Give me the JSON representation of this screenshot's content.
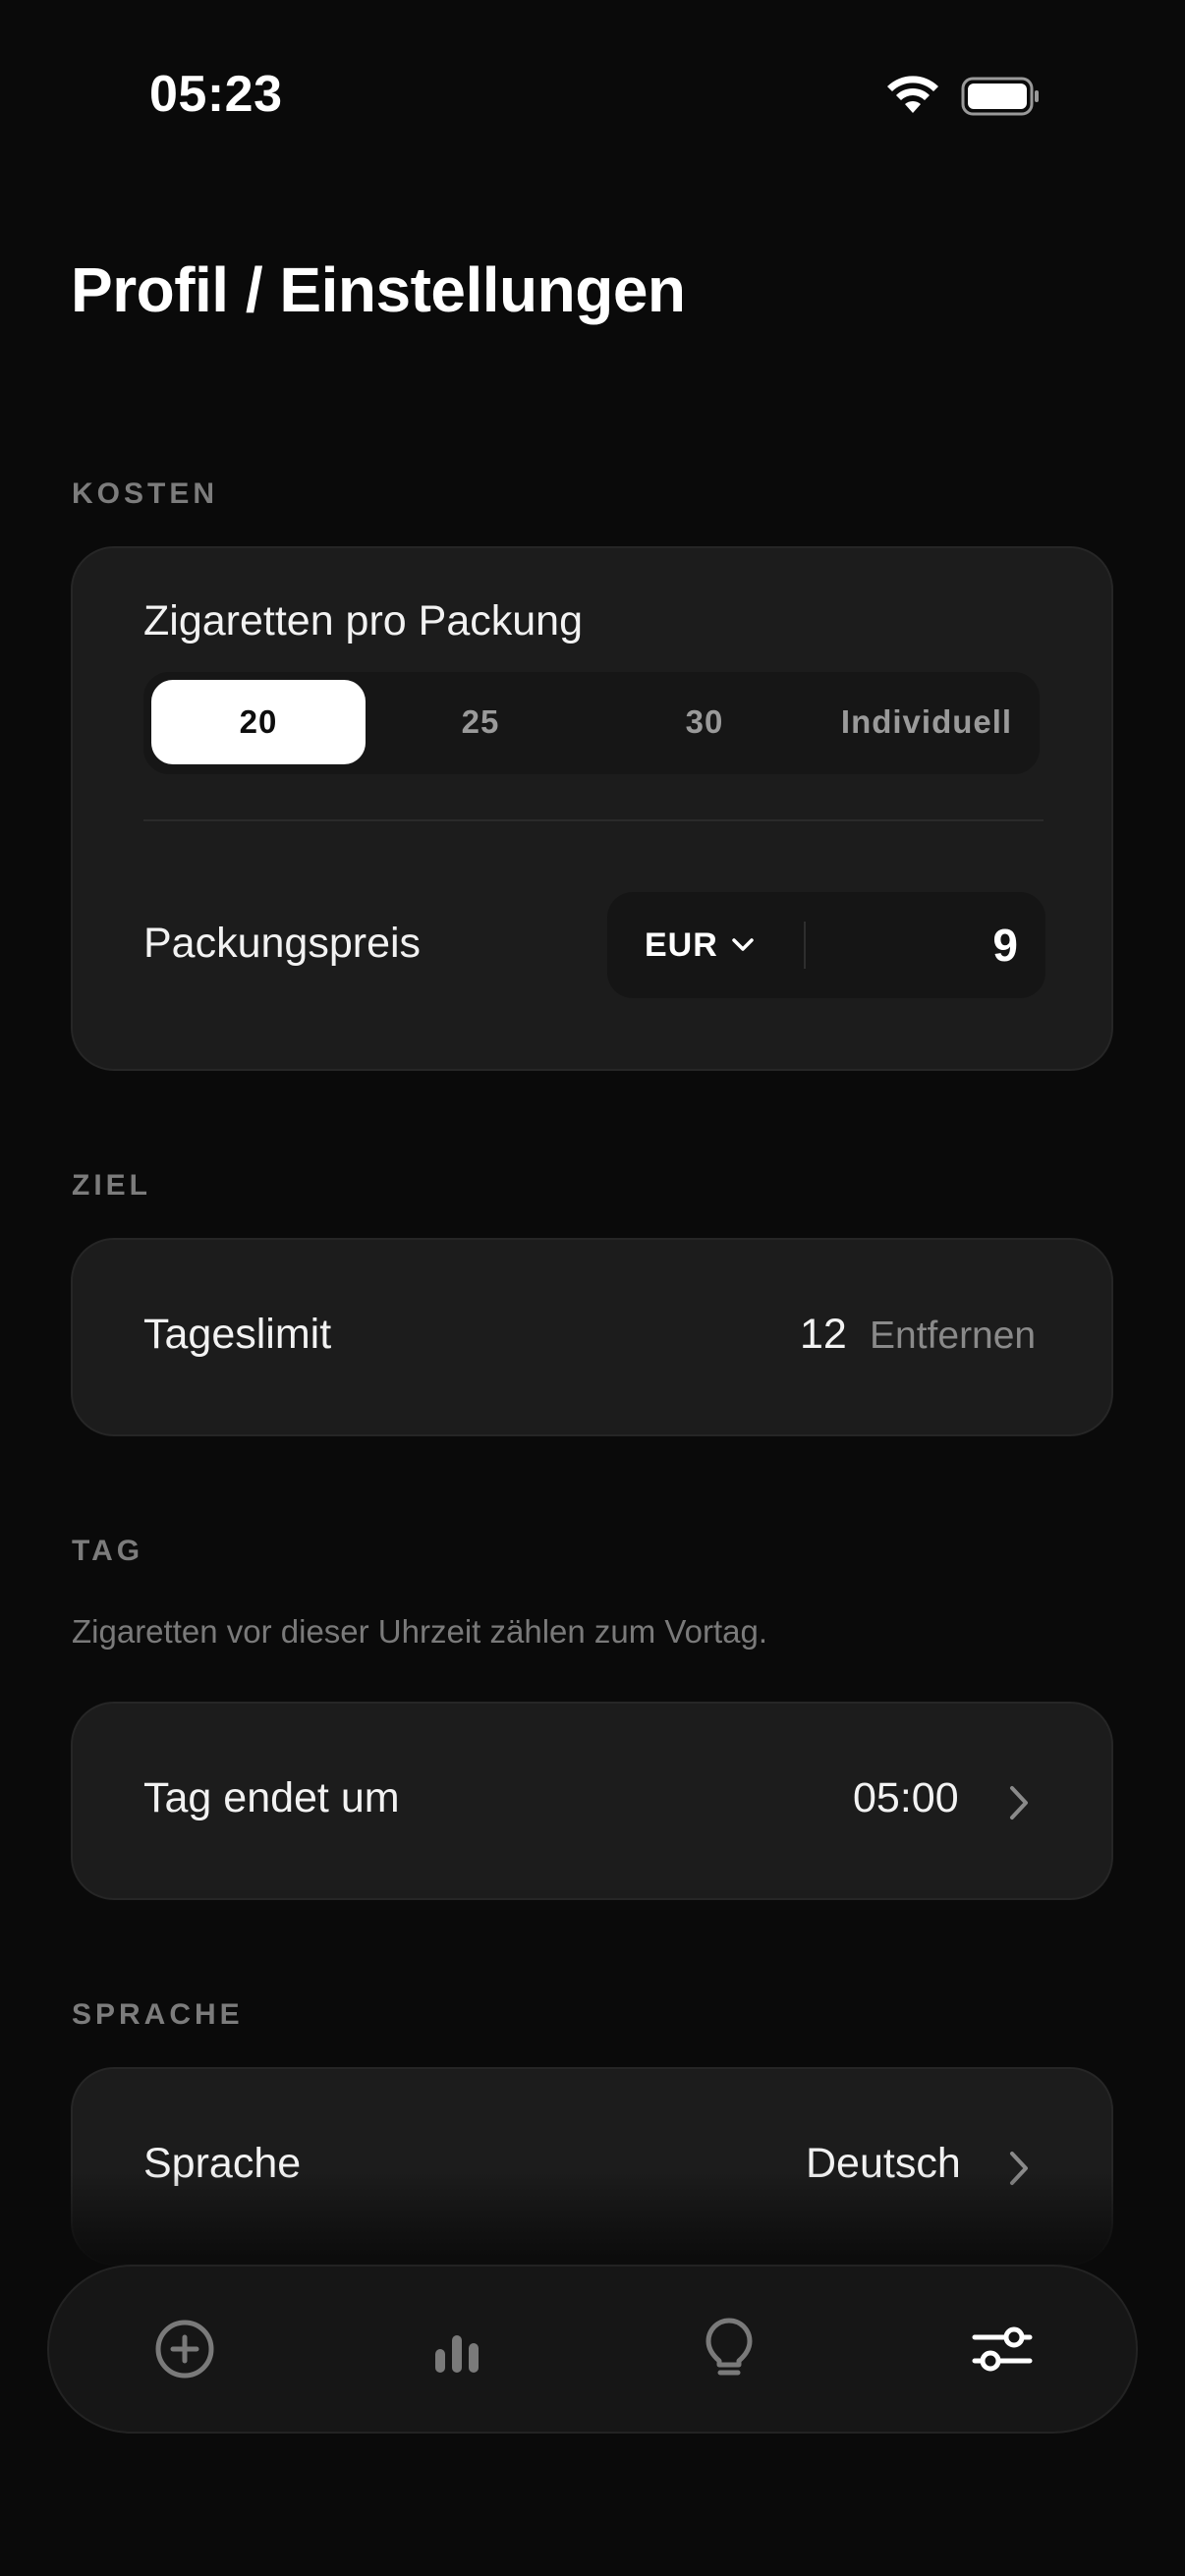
{
  "status_bar": {
    "time": "05:23",
    "icons": [
      "wifi-icon",
      "battery-icon"
    ]
  },
  "title": "Profil / Einstellungen",
  "sections": {
    "kosten": {
      "label": "KOSTEN",
      "cigs_per_pack_label": "Zigaretten pro Packung",
      "cigs_options": [
        "20",
        "25",
        "30",
        "Individuell"
      ],
      "cigs_selected": "20",
      "pack_price_label": "Packungspreis",
      "currency": "EUR",
      "price": "9"
    },
    "ziel": {
      "label": "ZIEL",
      "daily_limit_label": "Tageslimit",
      "daily_limit_value": "12",
      "remove_label": "Entfernen"
    },
    "tag": {
      "label": "TAG",
      "hint": "Zigaretten vor dieser Uhrzeit zählen zum Vortag.",
      "day_ends_label": "Tag endet um",
      "day_ends_value": "05:00"
    },
    "sprache": {
      "label": "SPRACHE",
      "language_label": "Sprache",
      "language_value": "Deutsch"
    }
  },
  "tab_bar": {
    "tabs": [
      "add-circle-icon",
      "bar-chart-icon",
      "lightbulb-icon",
      "sliders-icon"
    ],
    "active": "sliders-icon"
  },
  "colors": {
    "background": "#0a0a0a",
    "card": "#1c1c1c",
    "accent": "#ffffff",
    "muted_text": "#7c7c7c"
  }
}
